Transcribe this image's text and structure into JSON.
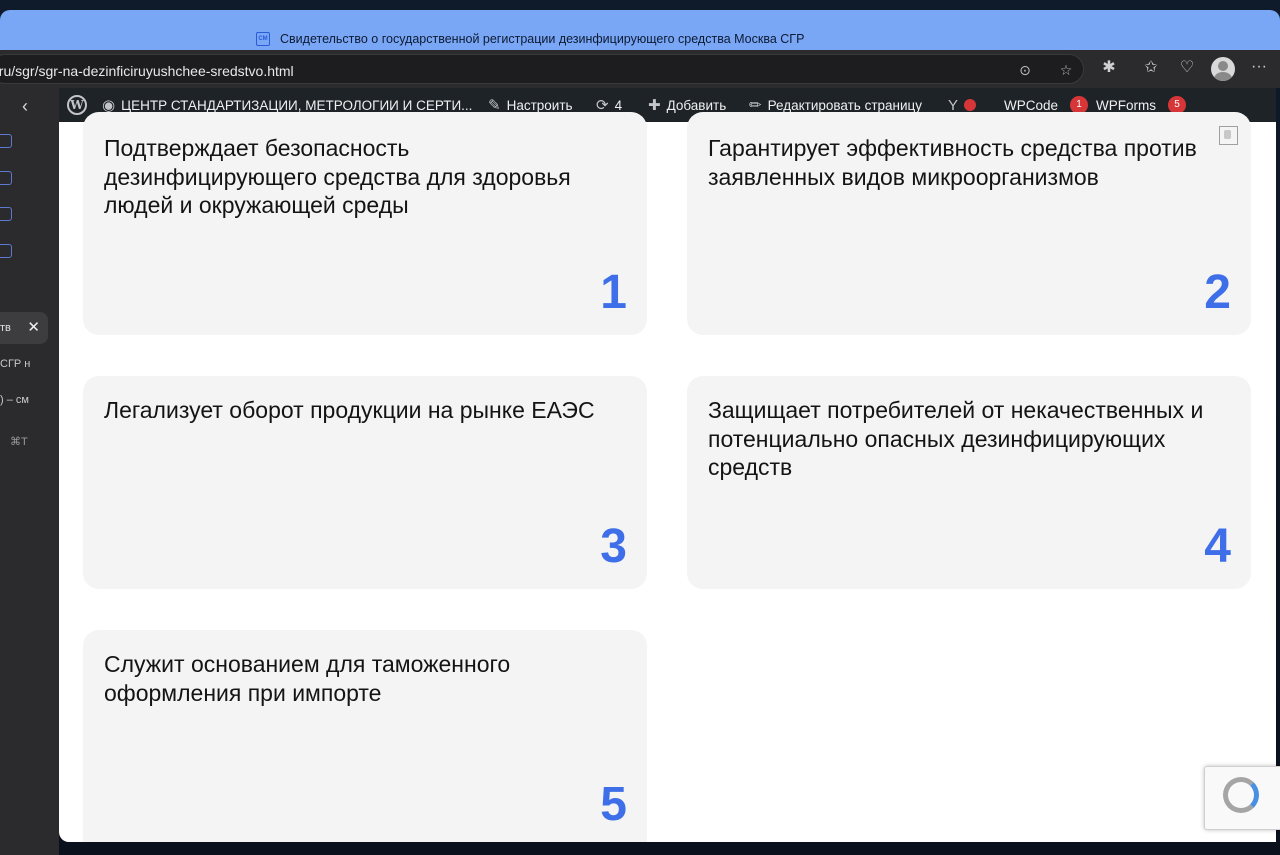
{
  "browser": {
    "tab_title": "Свидетельство о государственной регистрации дезинфицирующего средства Москва СГР",
    "url": "r.ru/sgr/sgr-na-dezinficiruyushchee-sredstvo.html"
  },
  "sidebar": {
    "items": [
      {
        "label": "тв",
        "close": "✕"
      },
      {
        "label": "СГР н"
      },
      {
        "label": ") – см"
      },
      {
        "label": "⌘T"
      }
    ]
  },
  "admin_bar": {
    "site_name": "ЦЕНТР СТАНДАРТИЗАЦИИ, МЕТРОЛОГИИ И СЕРТИ...",
    "customize": "Настроить",
    "updates_count": "4",
    "add_new": "Добавить",
    "edit_page": "Редактировать страницу",
    "wpcode": "WPCode",
    "wpcode_badge": "1",
    "wpforms": "WPForms",
    "wpforms_badge": "5"
  },
  "cards": [
    {
      "text": "Подтверждает безопасность дезинфицирующего средства для здоровья людей и окружающей среды",
      "number": "1"
    },
    {
      "text": "Гарантирует эффективность средства против заявленных видов микроорганизмов",
      "number": "2"
    },
    {
      "text": "Легализует оборот продукции на рынке ЕАЭС",
      "number": "3"
    },
    {
      "text": "Защищает потребителей от некачественных и потенциально опасных дезинфицирующих средств",
      "number": "4"
    },
    {
      "text": "Служит основанием для таможенного оформления при импорте",
      "number": "5"
    }
  ],
  "colors": {
    "accent_number": "#3f6fe8",
    "card_bg": "#f4f4f5",
    "admin_bar_bg": "#1d2327",
    "tab_strip": "#7aa7f5"
  }
}
